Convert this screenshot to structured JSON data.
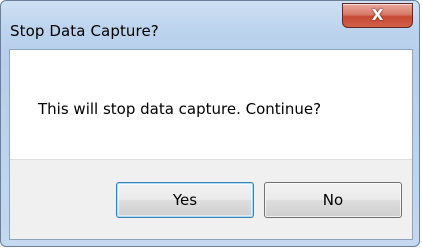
{
  "window": {
    "title": "Stop Data Capture?",
    "close_icon": "close-icon",
    "close_glyph": "X"
  },
  "message": {
    "text": "This will stop data capture. Continue?"
  },
  "buttons": {
    "yes_label": "Yes",
    "no_label": "No"
  },
  "colors": {
    "close_button": "#c74a36",
    "title_bar": "#bcd3ee",
    "button_bar": "#f0f0f0"
  }
}
